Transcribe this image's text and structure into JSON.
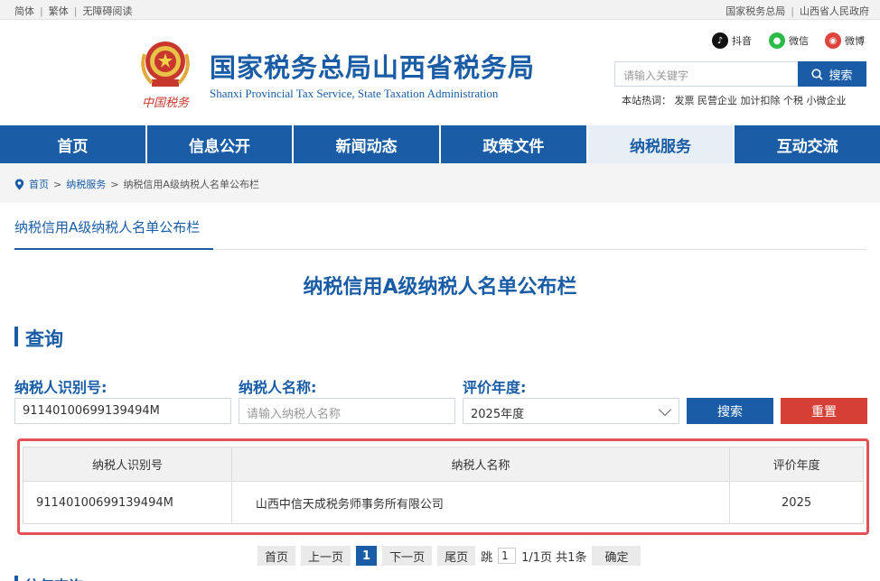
{
  "topbar": {
    "left": [
      "简体",
      "繁体",
      "无障碍阅读"
    ],
    "right": [
      "国家税务总局",
      "山西省人民政府"
    ]
  },
  "header": {
    "title": "国家税务总局山西省税务局",
    "subtitle": "Shanxi Provincial Tax Service, State Taxation Administration",
    "logo_text": "中国税务",
    "social": [
      "抖音",
      "微信",
      "微博"
    ],
    "search_placeholder": "请输入关键字",
    "search_button": "搜索",
    "hot_search": "本站热词：  发票 民营企业 加计扣除 个税 小微企业"
  },
  "nav": [
    "首页",
    "信息公开",
    "新闻动态",
    "政策文件",
    "纳税服务",
    "互动交流"
  ],
  "nav_active_index": 4,
  "breadcrumb": [
    "首页",
    "纳税服务",
    "纳税信用A级纳税人名单公布栏"
  ],
  "tab_label": "纳税信用A级纳税人名单公布栏",
  "page_heading": "纳税信用A级纳税人名单公布栏",
  "query": {
    "title": "查询",
    "taxpayer_id_label": "纳税人识别号:",
    "taxpayer_id_value": "91140100699139494M",
    "taxpayer_name_label": "纳税人名称:",
    "taxpayer_name_placeholder": "请输入纳税人名称",
    "year_label": "评价年度:",
    "year_value": "2025年度",
    "search_button": "搜索",
    "reset_button": "重置"
  },
  "table": {
    "headers": [
      "纳税人识别号",
      "纳税人名称",
      "评价年度"
    ],
    "rows": [
      [
        "91140100699139494M",
        "山西中信天成税务师事务所有限公司",
        "2025"
      ]
    ]
  },
  "pager": {
    "first": "首页",
    "prev": "上一页",
    "current": "1",
    "next": "下一页",
    "last": "尾页",
    "jump_label": "跳",
    "jump_value": "1",
    "info": "1/1页 共1条",
    "confirm": "确定"
  },
  "bottom_title": "往年查询",
  "colors": {
    "primary": "#1a5da6",
    "reset": "#d63f36",
    "highlight": "#e45156"
  }
}
